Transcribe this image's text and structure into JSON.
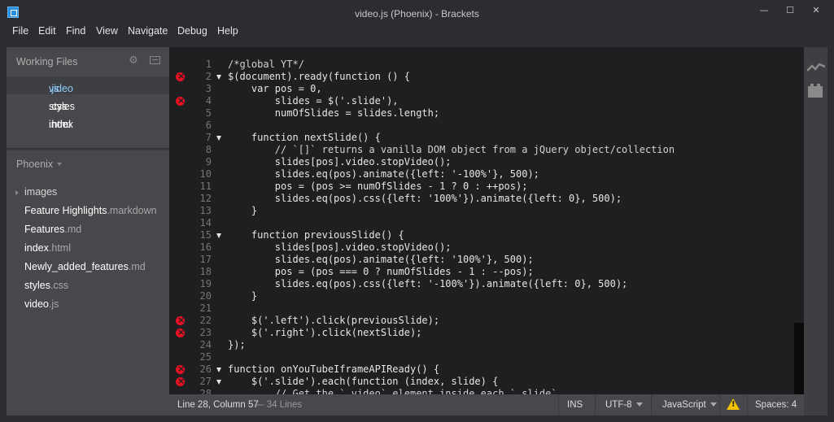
{
  "window": {
    "title": "video.js (Phoenix) - Brackets",
    "minimize": "—",
    "maximize": "☐",
    "close": "✕"
  },
  "menu": [
    "File",
    "Edit",
    "Find",
    "View",
    "Navigate",
    "Debug",
    "Help"
  ],
  "working_files": {
    "title": "Working Files",
    "files": [
      {
        "name": "video",
        "ext": ".js",
        "selected": true
      },
      {
        "name": "styles",
        "ext": ".css",
        "selected": false
      },
      {
        "name": "index",
        "ext": ".html",
        "selected": false
      }
    ]
  },
  "project": {
    "title": "Phoenix",
    "tree": [
      {
        "name": "images",
        "ext": "",
        "folder": true
      },
      {
        "name": "Feature Highlights",
        "ext": ".markdown"
      },
      {
        "name": "Features",
        "ext": ".md"
      },
      {
        "name": "index",
        "ext": ".html"
      },
      {
        "name": "Newly_added_features",
        "ext": ".md"
      },
      {
        "name": "styles",
        "ext": ".css"
      },
      {
        "name": "video",
        "ext": ".js"
      }
    ]
  },
  "editor": {
    "lines": [
      {
        "n": "1",
        "text": "/*global YT*/"
      },
      {
        "n": "2",
        "text": "$(document).ready(function () {",
        "err": true,
        "fold": true
      },
      {
        "n": "3",
        "text": "    var pos = 0,"
      },
      {
        "n": "4",
        "text": "        slides = $('.slide'),",
        "err": true
      },
      {
        "n": "5",
        "text": "        numOfSlides = slides.length;"
      },
      {
        "n": "6",
        "text": ""
      },
      {
        "n": "7",
        "text": "    function nextSlide() {",
        "fold": true
      },
      {
        "n": "8",
        "text": "        // `[]` returns a vanilla DOM object from a jQuery object/collection"
      },
      {
        "n": "9",
        "text": "        slides[pos].video.stopVideo();"
      },
      {
        "n": "10",
        "text": "        slides.eq(pos).animate({left: '-100%'}, 500);"
      },
      {
        "n": "11",
        "text": "        pos = (pos >= numOfSlides - 1 ? 0 : ++pos);"
      },
      {
        "n": "12",
        "text": "        slides.eq(pos).css({left: '100%'}).animate({left: 0}, 500);"
      },
      {
        "n": "13",
        "text": "    }"
      },
      {
        "n": "14",
        "text": ""
      },
      {
        "n": "15",
        "text": "    function previousSlide() {",
        "fold": true
      },
      {
        "n": "16",
        "text": "        slides[pos].video.stopVideo();"
      },
      {
        "n": "17",
        "text": "        slides.eq(pos).animate({left: '100%'}, 500);"
      },
      {
        "n": "18",
        "text": "        pos = (pos === 0 ? numOfSlides - 1 : --pos);"
      },
      {
        "n": "19",
        "text": "        slides.eq(pos).css({left: '-100%'}).animate({left: 0}, 500);"
      },
      {
        "n": "20",
        "text": "    }"
      },
      {
        "n": "21",
        "text": ""
      },
      {
        "n": "22",
        "text": "    $('.left').click(previousSlide);",
        "err": true
      },
      {
        "n": "23",
        "text": "    $('.right').click(nextSlide);",
        "err": true
      },
      {
        "n": "24",
        "text": "});"
      },
      {
        "n": "25",
        "text": ""
      },
      {
        "n": "26",
        "text": "function onYouTubeIframeAPIReady() {",
        "err": true,
        "fold": true
      },
      {
        "n": "27",
        "text": "    $('.slide').each(function (index, slide) {",
        "err": true,
        "fold": true
      },
      {
        "n": "28",
        "text": "        // Get the `.video` element inside each `.slide`"
      }
    ]
  },
  "statusbar": {
    "cursor": "Line 28, Column 57",
    "lines": "— 34 Lines",
    "mode": "INS",
    "encoding": "UTF-8",
    "language": "JavaScript",
    "warning": "!",
    "spaces": "Spaces:  4"
  },
  "colors": {
    "accent": "#8ecdfa",
    "error": "#e81123",
    "warning": "#f5c400"
  }
}
